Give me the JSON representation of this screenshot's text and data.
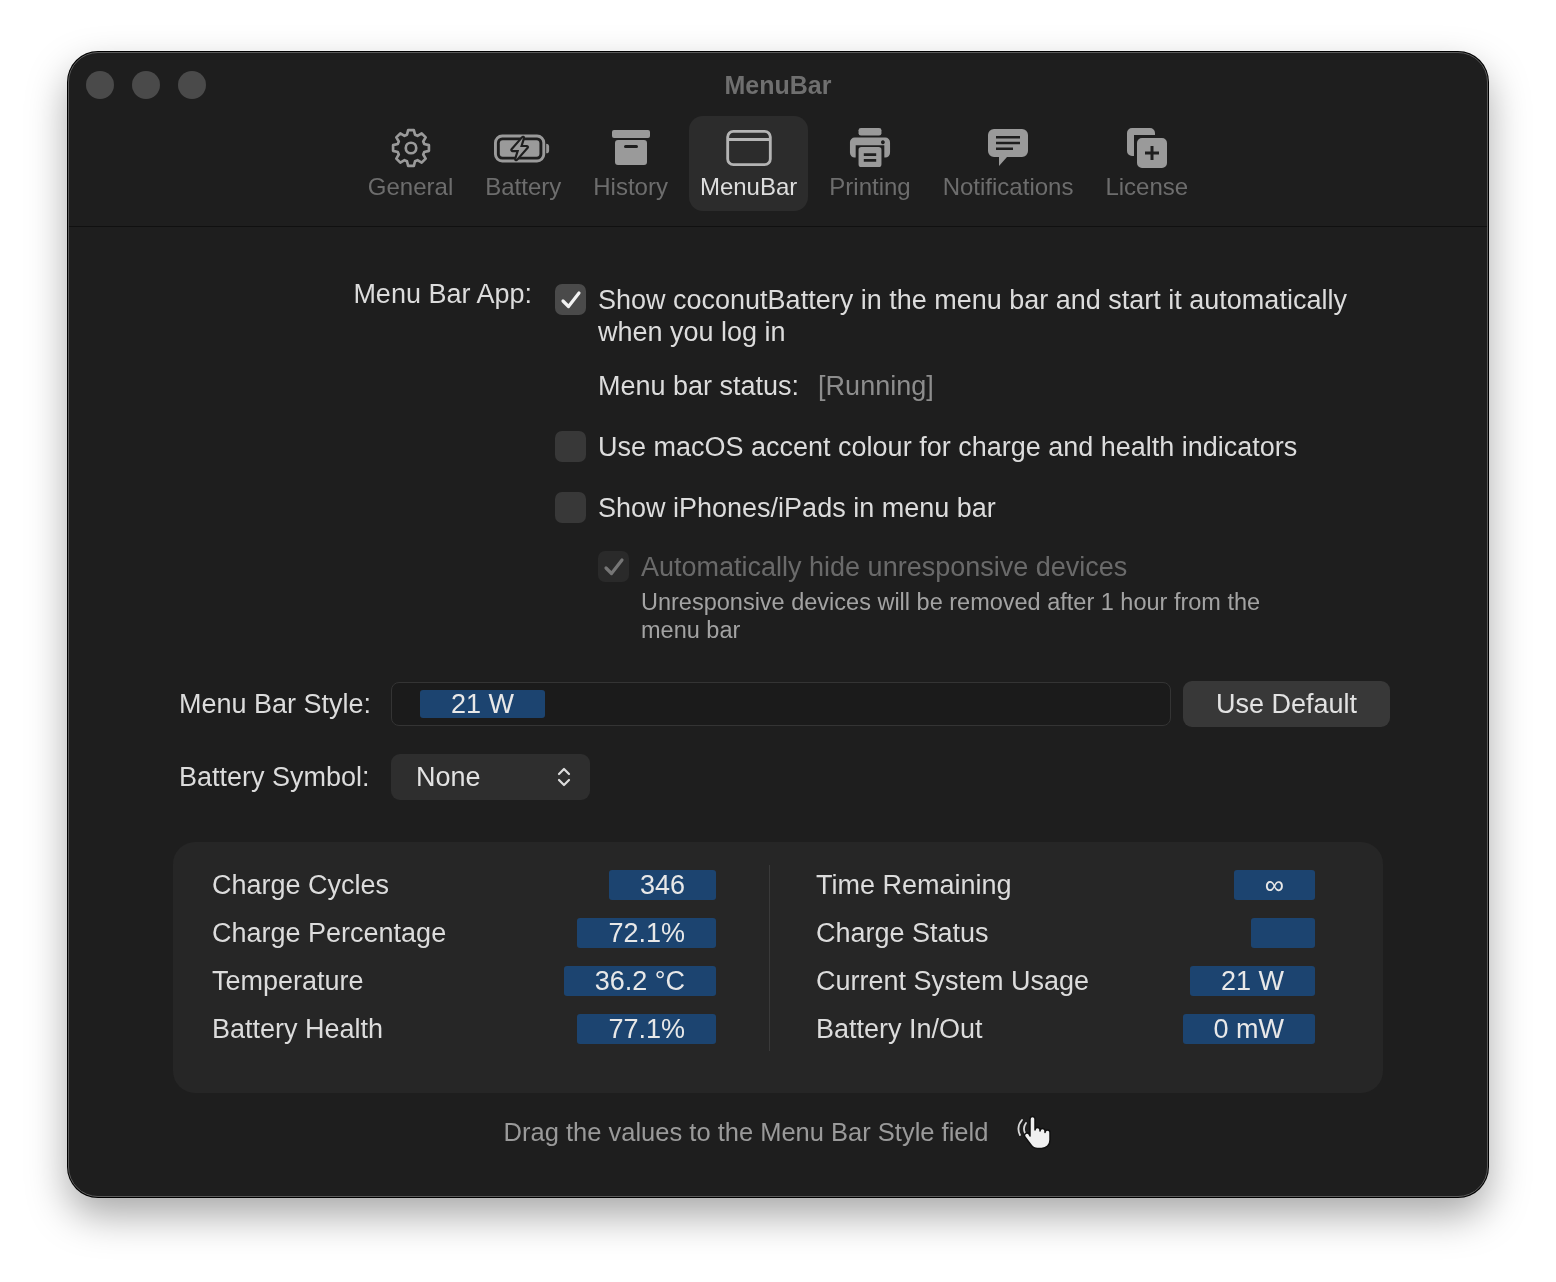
{
  "window": {
    "title": "MenuBar"
  },
  "toolbar": {
    "tabs": [
      {
        "label": "General",
        "selected": false
      },
      {
        "label": "Battery",
        "selected": false
      },
      {
        "label": "History",
        "selected": false
      },
      {
        "label": "MenuBar",
        "selected": true
      },
      {
        "label": "Printing",
        "selected": false
      },
      {
        "label": "Notifications",
        "selected": false
      },
      {
        "label": "License",
        "selected": false
      }
    ]
  },
  "menu_bar_app": {
    "label": "Menu Bar App:",
    "options": [
      {
        "label": "Show coconutBattery in the menu bar and start it automatically when you log in",
        "checked": true,
        "disabled": false,
        "status": {
          "label": "Menu bar status:",
          "value": "[Running]"
        }
      },
      {
        "label": "Use macOS accent colour for charge and health indicators",
        "checked": false,
        "disabled": false
      },
      {
        "label": "Show iPhones/iPads in menu bar",
        "checked": false,
        "disabled": false,
        "children": [
          {
            "label": "Automatically hide unresponsive devices",
            "checked": true,
            "disabled": true,
            "note": "Unresponsive devices will be removed after 1 hour from the menu bar"
          }
        ]
      }
    ]
  },
  "menu_bar_style": {
    "label": "Menu Bar Style:",
    "tokens": [
      "21 W"
    ],
    "button": "Use Default"
  },
  "battery_symbol": {
    "label": "Battery Symbol:",
    "value": "None"
  },
  "values_panel": {
    "columns": [
      {
        "rows": [
          {
            "label": "Charge Cycles",
            "value": "346"
          },
          {
            "label": "Charge Percentage",
            "value": "72.1%"
          },
          {
            "label": "Temperature",
            "value": "36.2 °C"
          },
          {
            "label": "Battery Health",
            "value": "77.1%"
          }
        ]
      },
      {
        "rows": [
          {
            "label": "Time Remaining",
            "value": "∞"
          },
          {
            "label": "Charge Status"
          },
          {
            "label": "Current System Usage",
            "value": "21 W"
          },
          {
            "label": "Battery In/Out",
            "value": "0 mW"
          }
        ]
      }
    ]
  },
  "hint": "Drag the values to the Menu Bar Style field"
}
